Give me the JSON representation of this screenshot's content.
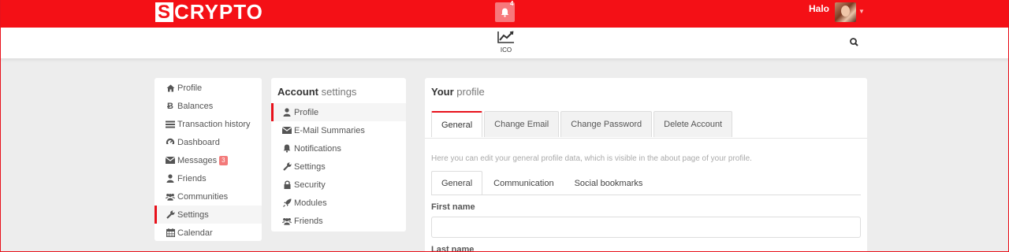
{
  "app": {
    "logo_letter": "S",
    "logo_text": "CRYPTO",
    "notification_count": "4",
    "greeting": "Halo"
  },
  "nav": {
    "items": [
      {
        "label": "ICO",
        "icon": "line-chart-icon"
      }
    ]
  },
  "left_menu": {
    "items": [
      {
        "label": "Profile",
        "icon": "home-icon"
      },
      {
        "label": "Balances",
        "icon": "bitcoin-icon"
      },
      {
        "label": "Transaction history",
        "icon": "list-icon"
      },
      {
        "label": "Dashboard",
        "icon": "dashboard-icon"
      },
      {
        "label": "Messages",
        "icon": "envelope-icon",
        "badge": "3"
      },
      {
        "label": "Friends",
        "icon": "user-icon"
      },
      {
        "label": "Communities",
        "icon": "users-icon"
      },
      {
        "label": "Settings",
        "icon": "wrench-icon",
        "active": true
      },
      {
        "label": "Calendar",
        "icon": "calendar-icon"
      }
    ]
  },
  "account": {
    "title_bold": "Account",
    "title_rest": "settings",
    "items": [
      {
        "label": "Profile",
        "icon": "user-icon",
        "active": true
      },
      {
        "label": "E-Mail Summaries",
        "icon": "envelope-icon"
      },
      {
        "label": "Notifications",
        "icon": "bell-icon"
      },
      {
        "label": "Settings",
        "icon": "wrench-icon"
      },
      {
        "label": "Security",
        "icon": "lock-icon"
      },
      {
        "label": "Modules",
        "icon": "rocket-icon"
      },
      {
        "label": "Friends",
        "icon": "users-icon"
      }
    ]
  },
  "profile": {
    "title_bold": "Your",
    "title_rest": "profile",
    "tabs": [
      "General",
      "Change Email",
      "Change Password",
      "Delete Account"
    ],
    "help_text": "Here you can edit your general profile data, which is visible in the about page of your profile.",
    "subtabs": [
      "General",
      "Communication",
      "Social bookmarks"
    ],
    "fields": [
      {
        "label": "First name",
        "value": "",
        "placeholder": ""
      },
      {
        "label": "Last name",
        "value": "",
        "placeholder": ""
      }
    ]
  },
  "colors": {
    "brand_red": "#f41016",
    "notification_bg": "#f7787c",
    "badge_bg": "#f37a7a"
  }
}
